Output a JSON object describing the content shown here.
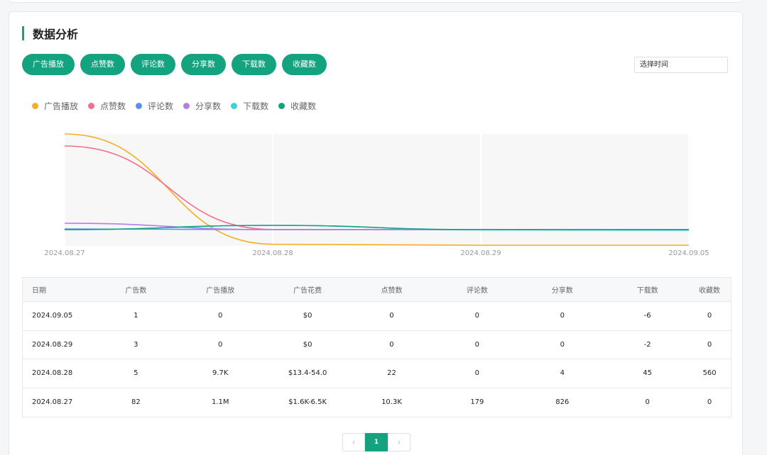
{
  "section": {
    "title": "数据分析"
  },
  "tabs": [
    "广告播放",
    "点赞数",
    "评论数",
    "分享数",
    "下载数",
    "收藏数"
  ],
  "date_picker": {
    "placeholder": "选择时间"
  },
  "chart_data": {
    "type": "line",
    "x": [
      "2024.08.27",
      "2024.08.28",
      "2024.08.29",
      "2024.09.05"
    ],
    "series": [
      {
        "name": "广告播放",
        "color": "#f5ae26",
        "values": [
          1100000,
          9700,
          0,
          0
        ]
      },
      {
        "name": "点赞数",
        "color": "#f2708a",
        "values": [
          10300,
          22,
          0,
          0
        ]
      },
      {
        "name": "评论数",
        "color": "#5b8ff0",
        "values": [
          179,
          0,
          0,
          0
        ]
      },
      {
        "name": "分享数",
        "color": "#b27ee8",
        "values": [
          826,
          4,
          0,
          0
        ]
      },
      {
        "name": "下载数",
        "color": "#3fcfdf",
        "values": [
          0,
          45,
          -2,
          -6
        ]
      },
      {
        "name": "收藏数",
        "color": "#14a37f",
        "values": [
          0,
          560,
          0,
          0
        ]
      }
    ]
  },
  "table": {
    "headers": [
      "日期",
      "广告数",
      "广告播放",
      "广告花费",
      "点赞数",
      "评论数",
      "分享数",
      "下载数",
      "收藏数"
    ],
    "rows": [
      [
        "2024.09.05",
        "1",
        "0",
        "$0",
        "0",
        "0",
        "0",
        "-6",
        "0"
      ],
      [
        "2024.08.29",
        "3",
        "0",
        "$0",
        "0",
        "0",
        "0",
        "-2",
        "0"
      ],
      [
        "2024.08.28",
        "5",
        "9.7K",
        "$13.4-54.0",
        "22",
        "0",
        "4",
        "45",
        "560"
      ],
      [
        "2024.08.27",
        "82",
        "1.1M",
        "$1.6K-6.5K",
        "10.3K",
        "179",
        "826",
        "0",
        "0"
      ]
    ]
  },
  "pagination": {
    "current": "1",
    "prev_icon": "chevron-left-icon",
    "next_icon": "chevron-right-icon"
  }
}
